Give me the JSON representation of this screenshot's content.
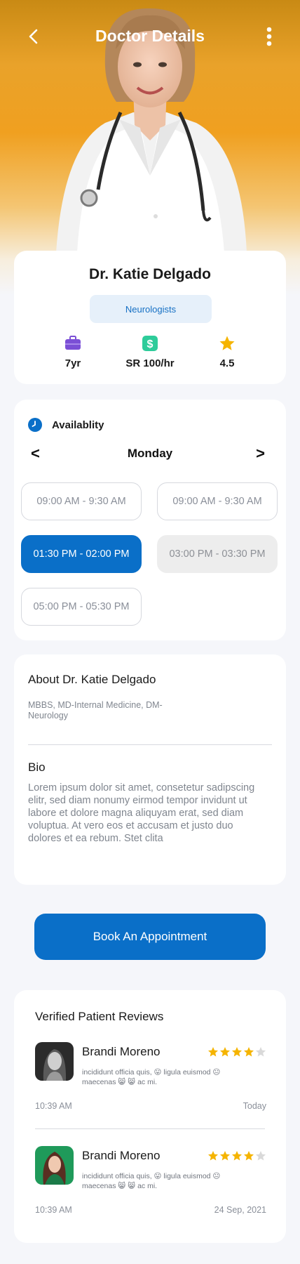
{
  "header": {
    "title": "Doctor Details"
  },
  "doctor": {
    "name": "Dr. Katie Delgado",
    "specialty": "Neurologists",
    "stats": [
      {
        "icon": "briefcase-icon",
        "value": "7yr"
      },
      {
        "icon": "dollar-icon",
        "value": "SR 100/hr"
      },
      {
        "icon": "star-icon",
        "value": "4.5"
      }
    ]
  },
  "availability": {
    "title": "Availablity",
    "day": "Monday",
    "prev": "<",
    "next": ">",
    "slots": [
      {
        "label": "09:00 AM - 9:30 AM",
        "state": "available"
      },
      {
        "label": "09:00 AM - 9:30 AM",
        "state": "available"
      },
      {
        "label": "01:30 PM - 02:00 PM",
        "state": "selected"
      },
      {
        "label": "03:00 PM - 03:30 PM",
        "state": "unavailable"
      },
      {
        "label": "05:00 PM - 05:30 PM",
        "state": "available"
      }
    ]
  },
  "about": {
    "title": "About Dr. Katie Delgado",
    "qualifications": "MBBS, MD-Internal Medicine, DM-Neurology",
    "bio_title": "Bio",
    "bio": "Lorem ipsum dolor sit amet, consetetur sadipscing elitr, sed diam nonumy eirmod tempor invidunt ut labore et dolore magna aliquyam erat, sed diam voluptua. At vero eos et accusam et justo duo dolores et ea rebum. Stet clita"
  },
  "book_button": "Book An Appointment",
  "reviews": {
    "title": "Verified Patient Reviews",
    "items": [
      {
        "name": "Brandi Moreno",
        "rating": 4,
        "text": "incididunt officia quis, 😛 ligula euismod 😐 maecenas 😸 😸 ac mi.",
        "time": "10:39 AM",
        "date": "Today"
      },
      {
        "name": "Brandi Moreno",
        "rating": 4,
        "text": "incididunt officia quis, 😛 ligula euismod 😐 maecenas 😸 😸 ac mi.",
        "time": "10:39 AM",
        "date": "24 Sep, 2021"
      }
    ]
  },
  "colors": {
    "primary": "#0A6FC8",
    "accent_orange": "#F0A020",
    "star": "#F5B400",
    "badge_bg": "#E6F0FA"
  }
}
